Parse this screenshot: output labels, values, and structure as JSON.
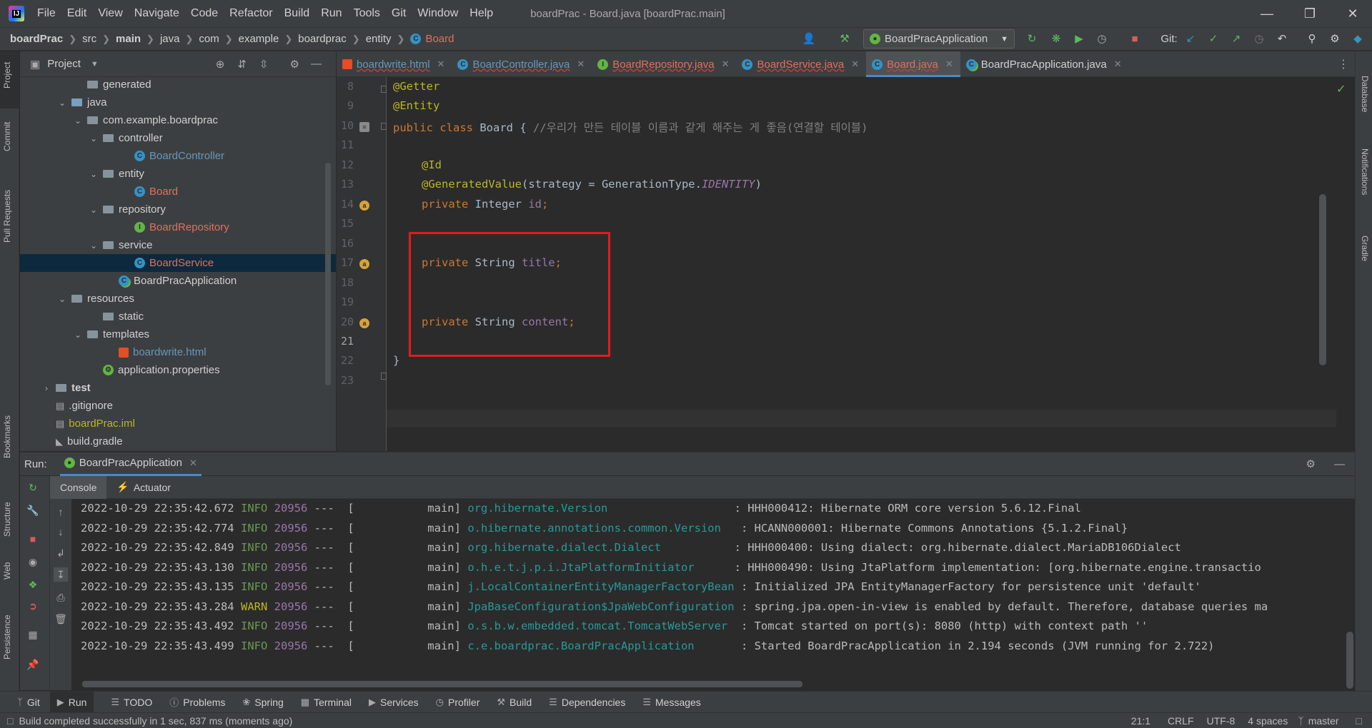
{
  "menubar": {
    "logo": "IJ",
    "items": [
      "File",
      "Edit",
      "View",
      "Navigate",
      "Code",
      "Refactor",
      "Build",
      "Run",
      "Tools",
      "Git",
      "Window",
      "Help"
    ],
    "window_title": "boardPrac - Board.java [boardPrac.main]"
  },
  "breadcrumb": [
    "boardPrac",
    "src",
    "main",
    "java",
    "com",
    "example",
    "boardprac",
    "entity",
    "Board"
  ],
  "toolbar": {
    "run_config": "BoardPracApplication",
    "git_label": "Git:"
  },
  "left_strip": [
    "Project",
    "Commit",
    "Pull Requests",
    "Bookmarks",
    "Structure",
    "Web",
    "Persistence"
  ],
  "right_strip": [
    "Database",
    "Notifications",
    "Gradle"
  ],
  "project_panel": {
    "title": "Project",
    "tree": [
      {
        "label": "generated",
        "indent": 4,
        "type": "folder",
        "chev": "",
        "color": "#cfcfcf"
      },
      {
        "label": "java",
        "indent": 3,
        "type": "folder-blue",
        "chev": "v",
        "color": "#cfcfcf"
      },
      {
        "label": "com.example.boardprac",
        "indent": 4,
        "type": "folder",
        "chev": "v",
        "color": "#cfcfcf"
      },
      {
        "label": "controller",
        "indent": 5,
        "type": "folder",
        "chev": "v",
        "color": "#cfcfcf"
      },
      {
        "label": "BoardController",
        "indent": 7,
        "type": "class",
        "chev": "",
        "color": "#6897bb"
      },
      {
        "label": "entity",
        "indent": 5,
        "type": "folder",
        "chev": "v",
        "color": "#cfcfcf"
      },
      {
        "label": "Board",
        "indent": 7,
        "type": "class",
        "chev": "",
        "color": "#e0705e"
      },
      {
        "label": "repository",
        "indent": 5,
        "type": "folder",
        "chev": "v",
        "color": "#cfcfcf"
      },
      {
        "label": "BoardRepository",
        "indent": 7,
        "type": "interface",
        "chev": "",
        "color": "#e0705e"
      },
      {
        "label": "service",
        "indent": 5,
        "type": "folder",
        "chev": "v",
        "color": "#cfcfcf"
      },
      {
        "label": "BoardService",
        "indent": 7,
        "type": "class",
        "chev": "",
        "color": "#e0705e",
        "selected": true
      },
      {
        "label": "BoardPracApplication",
        "indent": 6,
        "type": "spring",
        "chev": "",
        "color": "#cfcfcf"
      },
      {
        "label": "resources",
        "indent": 3,
        "type": "folder",
        "chev": "v",
        "color": "#cfcfcf"
      },
      {
        "label": "static",
        "indent": 5,
        "type": "folder",
        "chev": "",
        "color": "#cfcfcf"
      },
      {
        "label": "templates",
        "indent": 4,
        "type": "folder",
        "chev": "v",
        "color": "#cfcfcf"
      },
      {
        "label": "boardwrite.html",
        "indent": 6,
        "type": "html",
        "chev": "",
        "color": "#6897bb"
      },
      {
        "label": "application.properties",
        "indent": 5,
        "type": "props",
        "chev": "",
        "color": "#cfcfcf"
      },
      {
        "label": "test",
        "indent": 2,
        "type": "folder",
        "chev": ">",
        "color": "#cfcfcf",
        "bold": true
      },
      {
        "label": ".gitignore",
        "indent": 2,
        "type": "file",
        "chev": "",
        "color": "#cfcfcf"
      },
      {
        "label": "boardPrac.iml",
        "indent": 2,
        "type": "file",
        "chev": "",
        "color": "#bbb529"
      },
      {
        "label": "build.gradle",
        "indent": 2,
        "type": "gradle",
        "chev": "",
        "color": "#cfcfcf"
      }
    ]
  },
  "editor_tabs": [
    {
      "label": "boardwrite.html",
      "kind": "html",
      "color": "#6897bb"
    },
    {
      "label": "BoardController.java",
      "kind": "class",
      "color": "#6897bb"
    },
    {
      "label": "BoardRepository.java",
      "kind": "interface",
      "color": "#e0705e"
    },
    {
      "label": "BoardService.java",
      "kind": "class",
      "color": "#e0705e"
    },
    {
      "label": "Board.java",
      "kind": "class",
      "color": "#e0705e",
      "active": true
    },
    {
      "label": "BoardPracApplication.java",
      "kind": "spring",
      "color": "#cfcfcf"
    }
  ],
  "code": {
    "line_numbers": [
      "8",
      "9",
      "10",
      "11",
      "12",
      "13",
      "14",
      "15",
      "16",
      "17",
      "18",
      "19",
      "20",
      "21",
      "22",
      "23"
    ],
    "l8": "@Getter",
    "l9": "@Entity",
    "l10_kw": "public class ",
    "l10_name": "Board { ",
    "l10_comment": "//우리가 만든 테이블 이름과 같게 해주는 게 좋음(연결할 테이블)",
    "l12": "@Id",
    "l13_ann": "@GeneratedValue",
    "l13_rest": "(strategy = GenerationType.",
    "l13_const": "IDENTITY",
    "l13_end": ")",
    "priv": "private ",
    "l14_type": "Integer ",
    "l14_field": "id",
    "l17_type": "String ",
    "l17_field": "title",
    "l20_type": "String ",
    "l20_field": "content",
    "semi": ";",
    "l22": "}"
  },
  "run_panel": {
    "label": "Run:",
    "config_tab": "BoardPracApplication",
    "subtabs": [
      "Console",
      "Actuator"
    ],
    "logs": [
      {
        "ts": "2022-10-29 22:35:42.672",
        "lvl": "INFO",
        "pid": "20956",
        "thread": "---  [           main]",
        "logger": "org.hibernate.Version                   ",
        "msg": ": HHH000412: Hibernate ORM core version 5.6.12.Final"
      },
      {
        "ts": "2022-10-29 22:35:42.774",
        "lvl": "INFO",
        "pid": "20956",
        "thread": "---  [           main]",
        "logger": "o.hibernate.annotations.common.Version   ",
        "msg": ": HCANN000001: Hibernate Commons Annotations {5.1.2.Final}"
      },
      {
        "ts": "2022-10-29 22:35:42.849",
        "lvl": "INFO",
        "pid": "20956",
        "thread": "---  [           main]",
        "logger": "org.hibernate.dialect.Dialect           ",
        "msg": ": HHH000400: Using dialect: org.hibernate.dialect.MariaDB106Dialect"
      },
      {
        "ts": "2022-10-29 22:35:43.130",
        "lvl": "INFO",
        "pid": "20956",
        "thread": "---  [           main]",
        "logger": "o.h.e.t.j.p.i.JtaPlatformInitiator      ",
        "msg": ": HHH000490: Using JtaPlatform implementation: [org.hibernate.engine.transactio"
      },
      {
        "ts": "2022-10-29 22:35:43.135",
        "lvl": "INFO",
        "pid": "20956",
        "thread": "---  [           main]",
        "logger": "j.LocalContainerEntityManagerFactoryBean",
        "msg": " : Initialized JPA EntityManagerFactory for persistence unit 'default'"
      },
      {
        "ts": "2022-10-29 22:35:43.284",
        "lvl": "WARN",
        "pid": "20956",
        "thread": "---  [           main]",
        "logger": "JpaBaseConfiguration$JpaWebConfiguration",
        "msg": " : spring.jpa.open-in-view is enabled by default. Therefore, database queries ma"
      },
      {
        "ts": "2022-10-29 22:35:43.492",
        "lvl": "INFO",
        "pid": "20956",
        "thread": "---  [           main]",
        "logger": "o.s.b.w.embedded.tomcat.TomcatWebServer ",
        "msg": " : Tomcat started on port(s): 8080 (http) with context path ''"
      },
      {
        "ts": "2022-10-29 22:35:43.499",
        "lvl": "INFO",
        "pid": "20956",
        "thread": "---  [           main]",
        "logger": "c.e.boardprac.BoardPracApplication      ",
        "msg": " : Started BoardPracApplication in 2.194 seconds (JVM running for 2.722)"
      }
    ]
  },
  "bottom_tools": [
    "Git",
    "Run",
    "TODO",
    "Problems",
    "Spring",
    "Terminal",
    "Services",
    "Profiler",
    "Build",
    "Dependencies",
    "Messages"
  ],
  "statusbar": {
    "message": "Build completed successfully in 1 sec, 837 ms (moments ago)",
    "position": "21:1",
    "line_sep": "CRLF",
    "encoding": "UTF-8",
    "indent": "4 spaces",
    "branch": "master"
  }
}
